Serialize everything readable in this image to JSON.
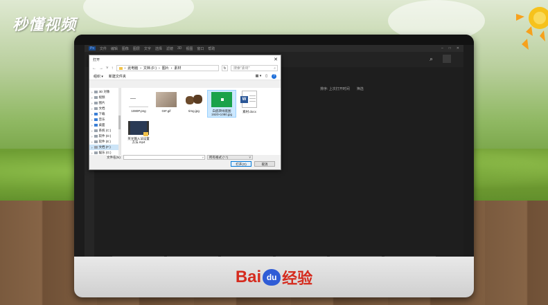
{
  "watermark": {
    "text": "秒懂视频"
  },
  "brand": {
    "baidu": "Bai",
    "du": "du",
    "suffix": "经验"
  },
  "app": {
    "menu": [
      "文件",
      "编辑",
      "图像",
      "图层",
      "文字",
      "选择",
      "滤镜",
      "3D",
      "视图",
      "窗口",
      "帮助"
    ],
    "sort_label": "排序: 上次打开时间",
    "filter_label": "筛选",
    "search_icon": "search-icon"
  },
  "dialog": {
    "title": "打开",
    "close": "✕",
    "path": [
      "此电脑",
      "文档 (F:)",
      "图片",
      "素材"
    ],
    "search_placeholder": "搜索\"素材\"",
    "organize": "组织 ▾",
    "new_folder": "新建文件夹",
    "help": "?",
    "tree": [
      {
        "label": "3D 对象",
        "icon": "gray"
      },
      {
        "label": "视频",
        "icon": "gray"
      },
      {
        "label": "图片",
        "icon": "gray"
      },
      {
        "label": "文档",
        "icon": "gray"
      },
      {
        "label": "下载",
        "icon": "blue"
      },
      {
        "label": "音乐",
        "icon": "blue"
      },
      {
        "label": "桌面",
        "icon": "blue"
      },
      {
        "label": "系统 (C:)",
        "icon": "gray"
      },
      {
        "label": "软件 (D:)",
        "icon": "gray"
      },
      {
        "label": "软件 (E:)",
        "icon": "gray"
      },
      {
        "label": "文档 (F:)",
        "icon": "gray"
      },
      {
        "label": "娱乐 (G:)",
        "icon": "gray"
      }
    ],
    "active_tree_index": 10,
    "files": [
      {
        "name": "1080P.png"
      },
      {
        "name": "GIF.gif"
      },
      {
        "name": "timg.jpg"
      },
      {
        "name": "白底转绿底图\n1920×1080.jpg"
      },
      {
        "name": "素材.docx"
      },
      {
        "name": "英文输入法设置\n方法.mp4"
      }
    ],
    "filename_label": "文件名(N):",
    "filetype": "所有格式 (*.*)",
    "open_button": "打开(O)",
    "cancel_button": "取消"
  }
}
